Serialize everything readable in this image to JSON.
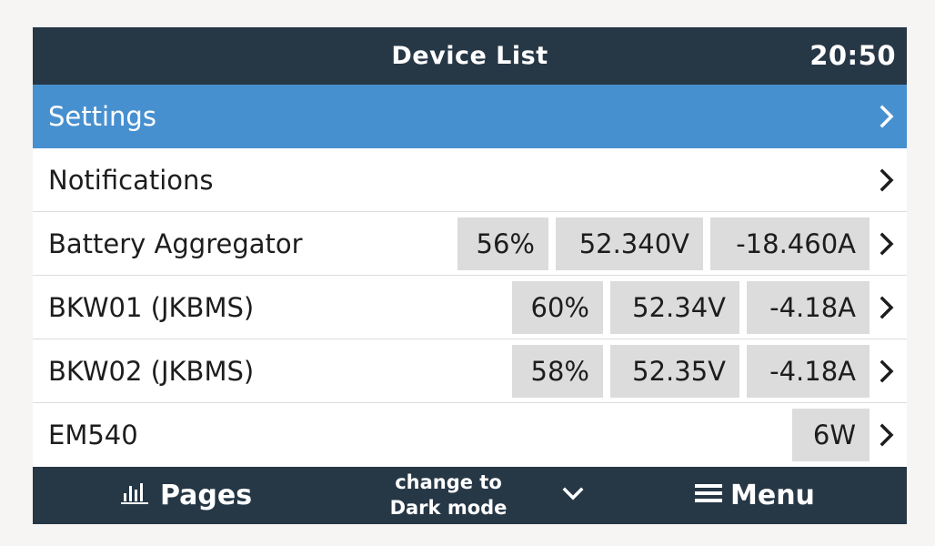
{
  "header": {
    "title": "Device List",
    "clock": "20:50"
  },
  "rows": [
    {
      "label": "Settings",
      "badges": []
    },
    {
      "label": "Notifications",
      "badges": []
    },
    {
      "label": "Battery Aggregator",
      "badges": [
        "56%",
        "52.340V",
        "-18.460A"
      ]
    },
    {
      "label": "BKW01 (JKBMS)",
      "badges": [
        "60%",
        "52.34V",
        "-4.18A"
      ]
    },
    {
      "label": "BKW02 (JKBMS)",
      "badges": [
        "58%",
        "52.35V",
        "-4.18A"
      ]
    },
    {
      "label": "EM540",
      "badges": [
        "6W"
      ]
    }
  ],
  "footer": {
    "pages_label": "Pages",
    "mode_line1": "change to",
    "mode_line2": "Dark mode",
    "menu_label": "Menu"
  },
  "colors": {
    "header_bg": "#263746",
    "selected_bg": "#4790d0",
    "badge_bg": "#dcdcdc"
  },
  "icons": {
    "pages": "bar-chart-icon",
    "mode_toggle": "chevron-down-icon",
    "menu": "hamburger-menu-icon",
    "row_arrow": "chevron-right-icon"
  }
}
